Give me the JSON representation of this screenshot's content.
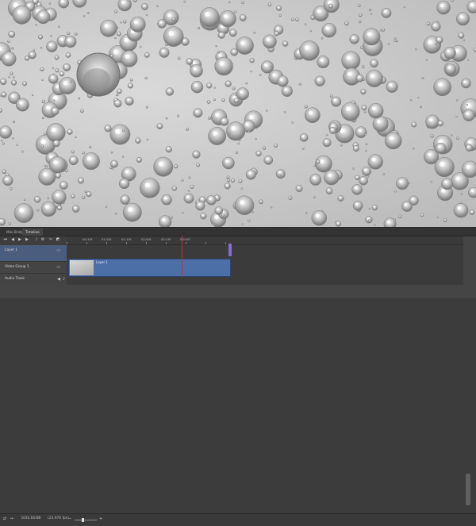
{
  "panel": {
    "tabs": [
      {
        "label": "Mini Bridge"
      },
      {
        "label": "Timeline"
      }
    ],
    "ruler_ticks": [
      "00:15f",
      "01:00f",
      "01:15f",
      "02:00f",
      "02:15f",
      "03:00f"
    ],
    "playhead_label": "02:15f",
    "layers": {
      "layer_label": "Layer 1",
      "video_group_label": "Video Group 1",
      "audio_label": "Audio Track"
    },
    "clip_label": "Layer 1",
    "time": "0:01:16:08",
    "fps": "(23.976 fps)",
    "zoom_minus": "−",
    "zoom_plus": "+"
  }
}
